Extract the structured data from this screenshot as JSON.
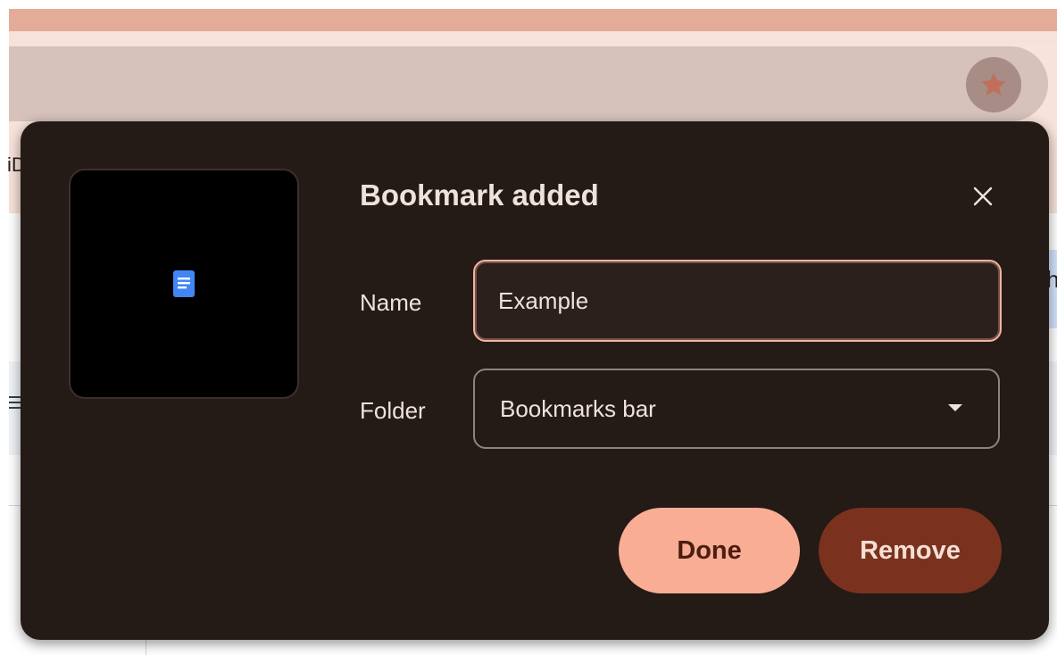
{
  "browser": {
    "bookmark_star_icon": "star-icon",
    "peek_left_text": "iD",
    "peek_right_text": "h"
  },
  "dialog": {
    "title": "Bookmark added",
    "thumbnail_icon": "google-docs-icon",
    "close_icon": "close-icon",
    "name_label": "Name",
    "name_value": "Example",
    "folder_label": "Folder",
    "folder_value": "Bookmarks bar",
    "done_label": "Done",
    "remove_label": "Remove"
  },
  "colors": {
    "dialog_bg": "#241a16",
    "accent": "#f9ad95",
    "remove_bg": "#7a321f",
    "doc_icon_blue": "#4285f4",
    "star": "#c0705a"
  }
}
